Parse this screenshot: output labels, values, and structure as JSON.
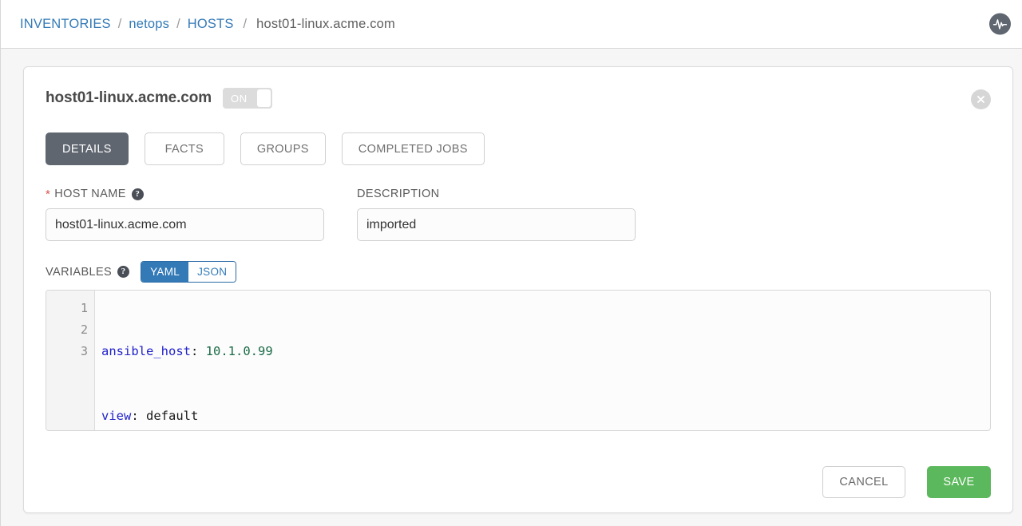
{
  "breadcrumb": {
    "items": [
      {
        "label": "INVENTORIES",
        "current": false
      },
      {
        "label": "netops",
        "current": false
      },
      {
        "label": "HOSTS",
        "current": false
      },
      {
        "label": "host01-linux.acme.com",
        "current": true
      }
    ],
    "separator": "/"
  },
  "header": {
    "pulse_icon": "activity-pulse-icon"
  },
  "card": {
    "title": "host01-linux.acme.com",
    "toggle": {
      "label": "ON",
      "state": "on"
    },
    "close_icon": "close-icon"
  },
  "tabs": [
    {
      "label": "DETAILS",
      "active": true
    },
    {
      "label": "FACTS",
      "active": false
    },
    {
      "label": "GROUPS",
      "active": false
    },
    {
      "label": "COMPLETED JOBS",
      "active": false
    }
  ],
  "form": {
    "host_name": {
      "label": "HOST NAME",
      "required_marker": "*",
      "help_icon": "question-mark-icon",
      "value": "host01-linux.acme.com",
      "placeholder": ""
    },
    "description": {
      "label": "DESCRIPTION",
      "value": "imported",
      "placeholder": ""
    }
  },
  "variables": {
    "label": "VARIABLES",
    "help_icon": "question-mark-icon",
    "modes": [
      {
        "label": "YAML",
        "active": true
      },
      {
        "label": "JSON",
        "active": false
      }
    ],
    "line_numbers": [
      "1",
      "2",
      "3"
    ],
    "lines": [
      {
        "key": "ansible_host",
        "colon": ":",
        "value": "10.1.0.99",
        "value_type": "number"
      },
      {
        "key": "view",
        "colon": ":",
        "value": "default",
        "value_type": "string"
      },
      {
        "key": "",
        "colon": "",
        "value": "",
        "value_type": "empty"
      }
    ]
  },
  "footer": {
    "cancel_label": "CANCEL",
    "save_label": "SAVE"
  },
  "colors": {
    "link": "#337ab7",
    "accent_blue": "#337ab7",
    "save_green": "#5cb85c",
    "tab_active": "#5f6670",
    "required_red": "#d9534f",
    "page_bg": "#f6f6f6"
  }
}
